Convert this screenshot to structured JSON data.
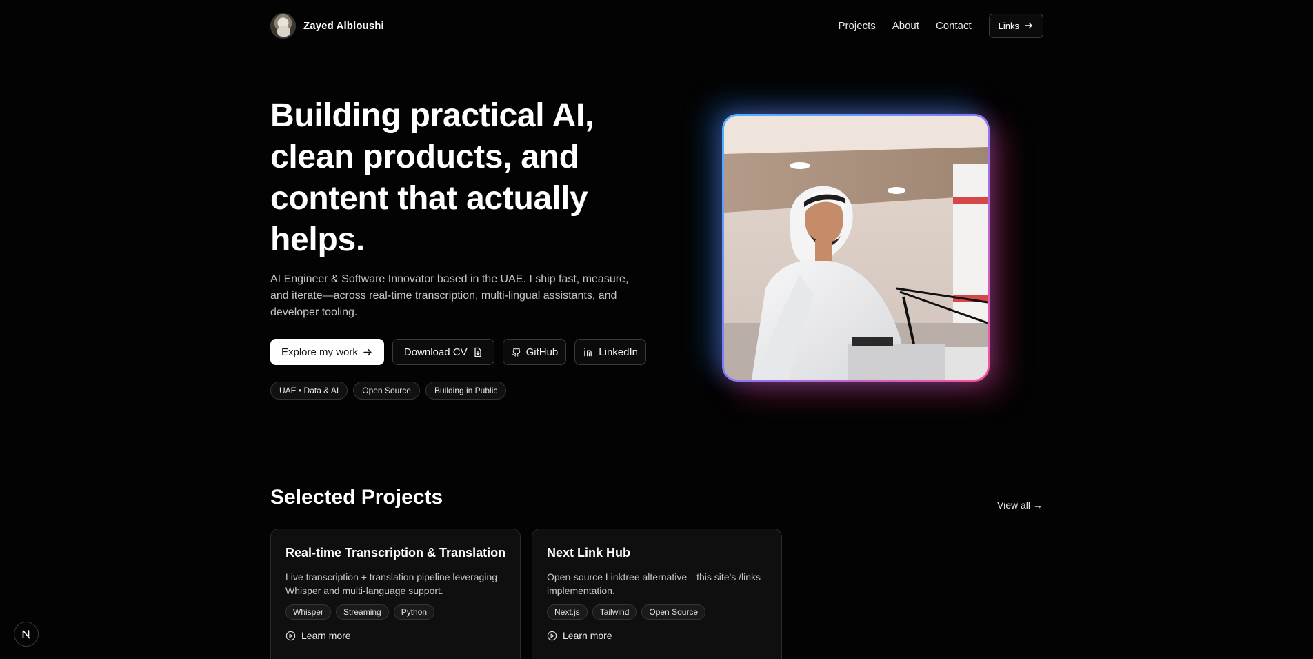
{
  "header": {
    "brand_name": "Zayed Albloushi",
    "nav": {
      "projects": "Projects",
      "about": "About",
      "contact": "Contact",
      "links_button": "Links"
    }
  },
  "hero": {
    "title": "Building practical AI, clean products, and content that actually helps.",
    "description": "AI Engineer & Software Innovator based in the UAE. I ship fast, measure, and iterate—across real-time transcription, multi-lingual assistants, and developer tooling.",
    "buttons": {
      "explore": "Explore my work",
      "download_cv": "Download CV",
      "github": "GitHub",
      "linkedin": "LinkedIn"
    },
    "chips": [
      "UAE • Data & AI",
      "Open Source",
      "Building in Public"
    ]
  },
  "projects": {
    "title": "Selected Projects",
    "view_all": "View all →",
    "cards": [
      {
        "title": "Real-time Transcription & Translation",
        "description": "Live transcription + translation pipeline leveraging Whisper and multi-language support.",
        "tags": [
          "Whisper",
          "Streaming",
          "Python"
        ],
        "cta": "Learn more"
      },
      {
        "title": "Next Link Hub",
        "description": "Open-source Linktree alternative—this site's /links implementation.",
        "tags": [
          "Next.js",
          "Tailwind",
          "Open Source"
        ],
        "cta": "Learn more"
      }
    ]
  },
  "icons": {
    "arrow_right": "arrow-right-icon",
    "file_download": "file-download-icon",
    "github": "github-icon",
    "linkedin": "linkedin-icon",
    "play_circle": "play-circle-icon",
    "next_logo": "nextjs-logo-icon"
  },
  "colors": {
    "background": "#030303",
    "glow_blue": "#4fb3ff",
    "glow_pink": "#ff4f9a"
  }
}
